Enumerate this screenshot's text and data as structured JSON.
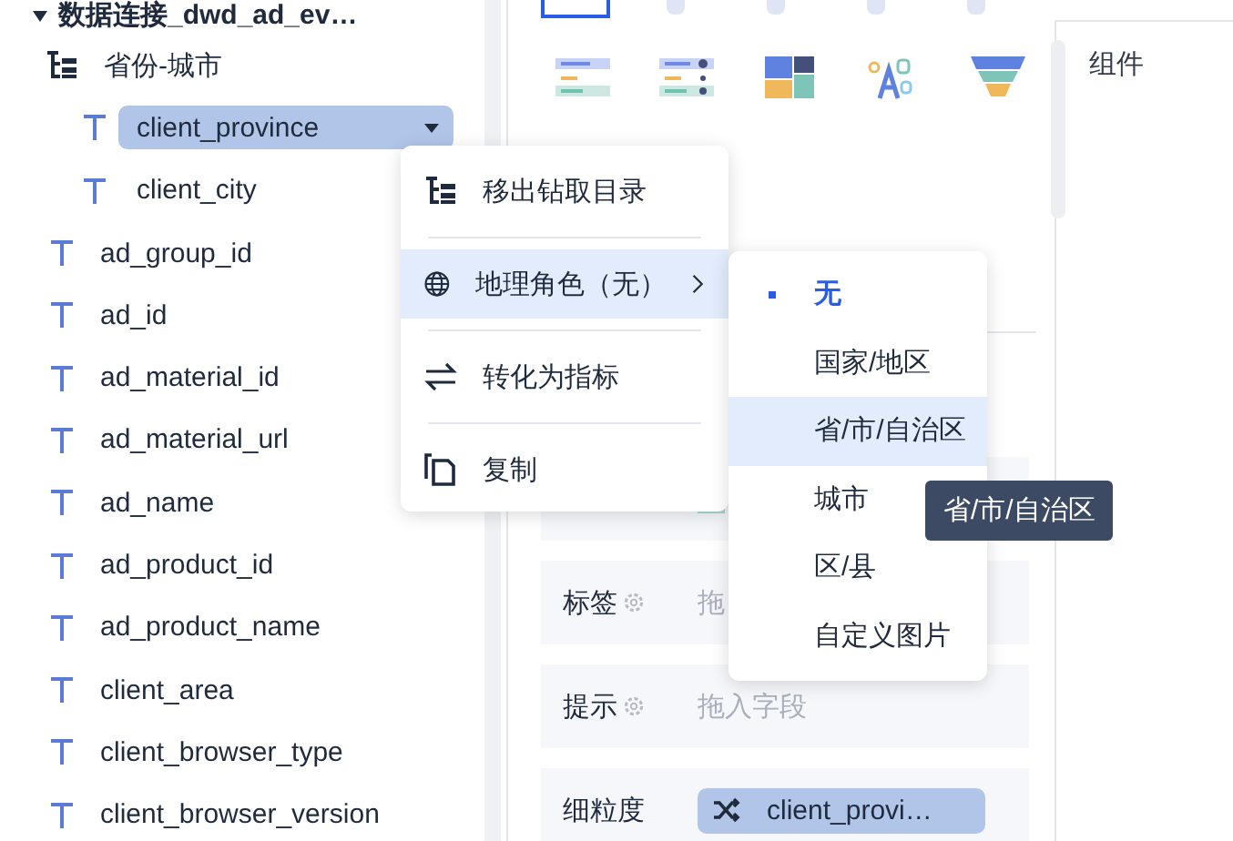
{
  "tree": {
    "source": "数据连接_dwd_ad_ev…",
    "group": {
      "label": "省份-城市",
      "children": [
        {
          "label": "client_province",
          "selected": true
        },
        {
          "label": "client_city",
          "selected": false
        }
      ]
    },
    "fields": [
      "ad_group_id",
      "ad_id",
      "ad_material_id",
      "ad_material_url",
      "ad_name",
      "ad_product_id",
      "ad_product_name",
      "client_area",
      "client_browser_type",
      "client_browser_version"
    ]
  },
  "chart_types": [
    {
      "kind": "ranking",
      "selected": false
    },
    {
      "kind": "ranking_dot",
      "selected": false
    },
    {
      "kind": "treemap",
      "selected": false
    },
    {
      "kind": "word_cloud",
      "selected": false
    },
    {
      "kind": "funnel",
      "selected": false
    }
  ],
  "top_chart_types": [
    {
      "selected": true
    },
    {
      "selected": false
    },
    {
      "selected": false
    },
    {
      "selected": false
    },
    {
      "selected": false
    }
  ],
  "field_rows": [
    {
      "label": "标签",
      "settings": true,
      "kind": "placeholder",
      "placeholder": "拖"
    },
    {
      "label": "提示",
      "settings": true,
      "kind": "placeholder",
      "placeholder": "拖入字段"
    },
    {
      "label": "细粒度",
      "settings": false,
      "kind": "chip",
      "value": "client_provi…"
    }
  ],
  "right_panel": {
    "title": "组件"
  },
  "context_menu": [
    {
      "kind": "drill",
      "label": "移出钻取目录",
      "highlighted": false,
      "submenu": false
    },
    {
      "kind": "globe",
      "label": "地理角色（无）",
      "highlighted": true,
      "submenu": true
    },
    {
      "kind": "swap",
      "label": "转化为指标",
      "highlighted": false,
      "submenu": false
    },
    {
      "kind": "copy",
      "label": "复制",
      "highlighted": false,
      "submenu": false
    }
  ],
  "geo_submenu": [
    {
      "label": "无",
      "selected": true,
      "highlighted": false
    },
    {
      "label": "国家/地区",
      "selected": false,
      "highlighted": false
    },
    {
      "label": "省/市/自治区",
      "selected": false,
      "highlighted": true
    },
    {
      "label": "城市",
      "selected": false,
      "highlighted": false
    },
    {
      "label": "区/县",
      "selected": false,
      "highlighted": false
    },
    {
      "label": "自定义图片",
      "selected": false,
      "highlighted": false
    }
  ],
  "tooltip": "省/市/自治区"
}
